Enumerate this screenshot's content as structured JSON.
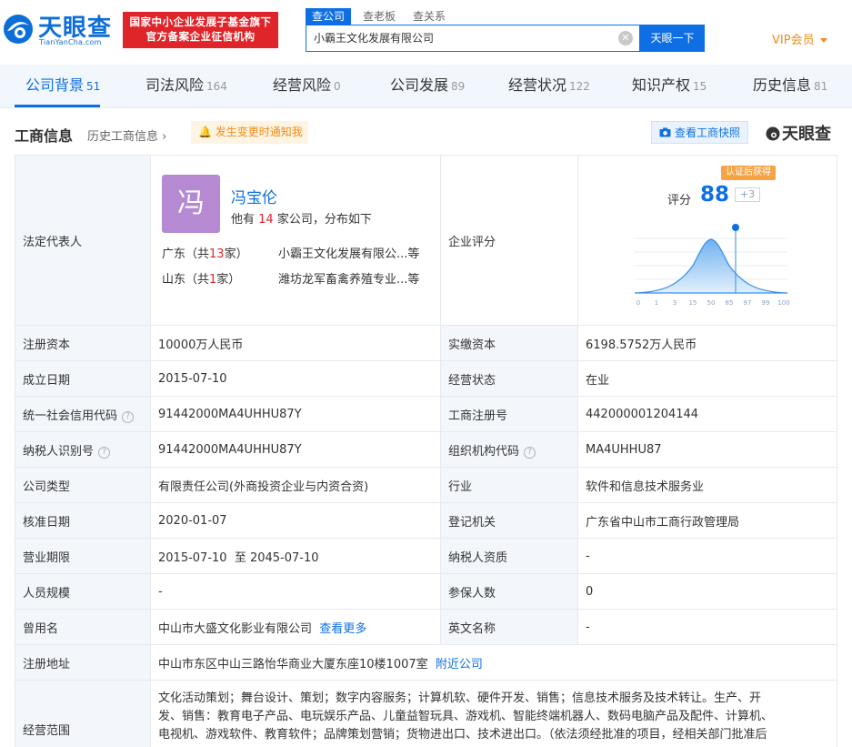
{
  "brand": {
    "logo_text": "天眼查",
    "logo_sub": "TianYanCha.com",
    "badge_line1": "国家中小企业发展子基金旗下",
    "badge_line2": "官方备案企业征信机构",
    "accent": "#0e6fe5",
    "badge_color": "#e0252a"
  },
  "search": {
    "tabs": [
      "查公司",
      "查老板",
      "查关系"
    ],
    "value": "小霸王文化发展有限公司",
    "button": "天眼一下",
    "clear_icon": "close-circle-icon"
  },
  "vip": {
    "label": "VIP会员"
  },
  "nav": [
    {
      "label": "公司背景",
      "count": "51"
    },
    {
      "label": "司法风险",
      "count": "164"
    },
    {
      "label": "经营风险",
      "count": "0"
    },
    {
      "label": "公司发展",
      "count": "89"
    },
    {
      "label": "经营状况",
      "count": "122"
    },
    {
      "label": "知识产权",
      "count": "15"
    },
    {
      "label": "历史信息",
      "count": "81"
    }
  ],
  "section": {
    "title": "工商信息",
    "history": "历史工商信息",
    "notify": "发生变更时通知我",
    "snapshot": "查看工商快照",
    "brand": "天眼查"
  },
  "legal_rep": {
    "label": "法定代表人",
    "avatar_char": "冯",
    "name": "冯宝伦",
    "desc_pre": "他有",
    "desc_num": "14",
    "desc_post": "家公司，分布如下",
    "regions": [
      {
        "pre": "广东（共",
        "num": "13",
        "post": "家）",
        "company": "小霸王文化发展有限公...等"
      },
      {
        "pre": "山东（共",
        "num": "1",
        "post": "家）",
        "company": "潍坊龙军畜禽养殖专业...等"
      }
    ]
  },
  "score": {
    "label": "企业评分",
    "score_label": "评分",
    "value": "88",
    "plus": "+3",
    "tag": "认证后获得",
    "axis_ticks": [
      "0",
      "1",
      "3",
      "15",
      "50",
      "85",
      "97",
      "99",
      "100"
    ]
  },
  "rows": [
    {
      "l1": "注册资本",
      "v1": "10000万人民币",
      "l2": "实缴资本",
      "v2": "6198.5752万人民币"
    },
    {
      "l1": "成立日期",
      "v1": "2015-07-10",
      "l2": "经营状态",
      "v2": "在业"
    },
    {
      "l1": "统一社会信用代码",
      "v1": "91442000MA4UHHU87Y",
      "l2": "工商注册号",
      "v2": "442000001204144"
    },
    {
      "l1": "纳税人识别号",
      "v1": "91442000MA4UHHU87Y",
      "l2": "组织机构代码",
      "v2": "MA4UHHU87"
    },
    {
      "l1": "公司类型",
      "v1": "有限责任公司(外商投资企业与内资合资)",
      "l2": "行业",
      "v2": "软件和信息技术服务业"
    },
    {
      "l1": "核准日期",
      "v1": "2020-01-07",
      "l2": "登记机关",
      "v2": "广东省中山市工商行政管理局"
    },
    {
      "l1": "营业期限",
      "v1": "2015-07-10  至 2045-07-10",
      "l2": "纳税人资质",
      "v2": "-"
    },
    {
      "l1": "人员规模",
      "v1": "-",
      "l2": "参保人数",
      "v2": "0"
    },
    {
      "l1": "曾用名",
      "v1": "中山市大盛文化影业有限公司",
      "v1_link": "查看更多",
      "l2": "英文名称",
      "v2": "-"
    }
  ],
  "address": {
    "label": "注册地址",
    "value": "中山市东区中山三路怡华商业大厦东座10楼1007室",
    "link": "附近公司"
  },
  "scope": {
    "label": "经营范围",
    "lines": [
      "文化活动策划；舞台设计、策划；数字内容服务；计算机软、硬件开发、销售；信息技术服务及技术转让。生产、开",
      "发、销售：教育电子产品、电玩娱乐产品、儿童益智玩具、游戏机、智能终端机器人、数码电脑产品及配件、计算机、",
      "电视机、游戏软件、教育软件；品牌策划营销；货物进出口、技术进出口。（依法须经批准的项目，经相关部门批准后"
    ]
  }
}
